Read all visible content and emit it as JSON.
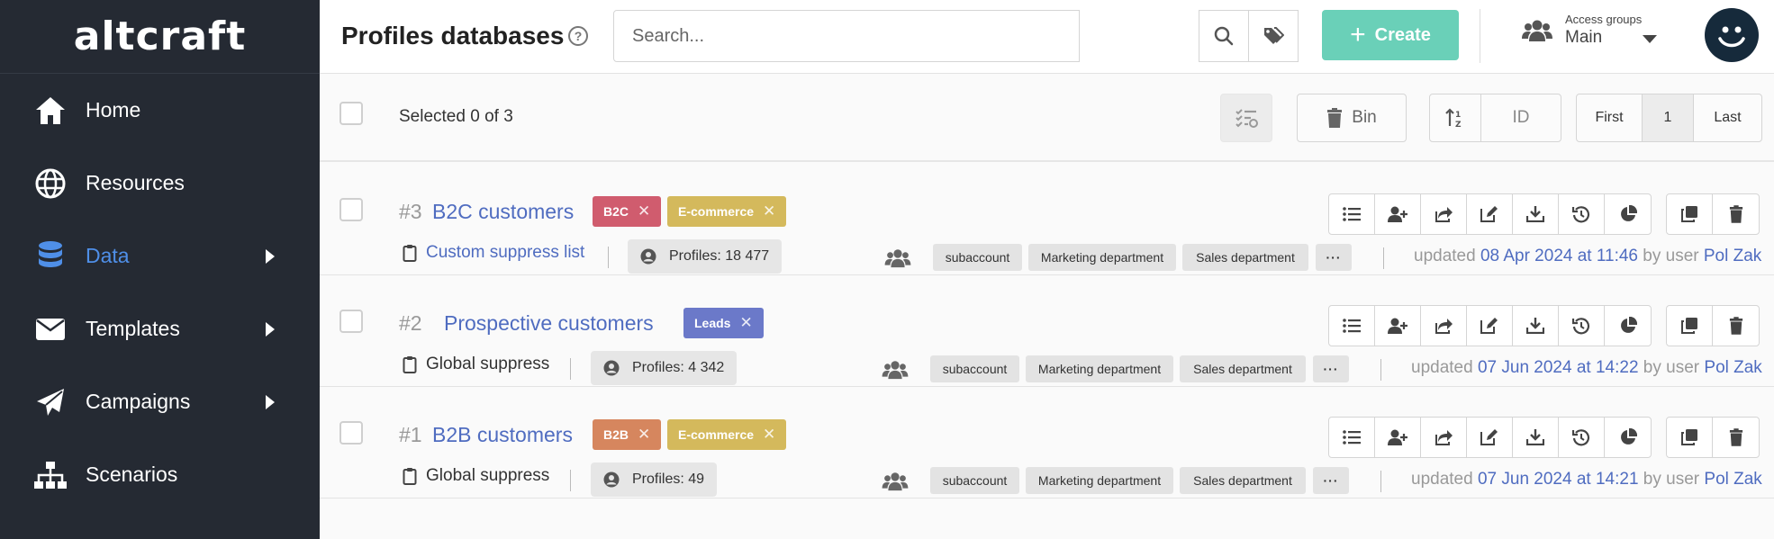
{
  "sidebar": {
    "logo": "altcraft",
    "items": [
      {
        "label": "Home",
        "icon": "home-icon"
      },
      {
        "label": "Resources",
        "icon": "globe-icon"
      },
      {
        "label": "Data",
        "icon": "database-icon"
      },
      {
        "label": "Templates",
        "icon": "envelope-icon"
      },
      {
        "label": "Campaigns",
        "icon": "paper-plane-icon"
      },
      {
        "label": "Scenarios",
        "icon": "sitemap-icon"
      }
    ]
  },
  "header": {
    "title": "Profiles databases",
    "help": "?",
    "search_placeholder": "Search...",
    "create_label": "Create",
    "access_caption": "Access groups",
    "access_value": "Main"
  },
  "toolbar": {
    "selected_text": "Selected 0 of 3",
    "bin_label": "Bin",
    "sort_field": "ID",
    "pager_first": "First",
    "pager_page": "1",
    "pager_last": "Last"
  },
  "rows": [
    {
      "id": "#3",
      "name": "B2C customers",
      "tags": [
        {
          "label": "B2C",
          "color": "#d05c6e"
        },
        {
          "label": "E-commerce",
          "color": "#d4b95c"
        }
      ],
      "suppress": "Custom suppress list",
      "profiles": "Profiles: 18 477",
      "groups": [
        "subaccount",
        "Marketing department",
        "Sales department"
      ],
      "more": "···",
      "updated_prefix": "updated",
      "updated_date": "08 Apr 2024 at 11:46",
      "updated_by": "by user",
      "user": "Pol Zak"
    },
    {
      "id": "#2",
      "name": "Prospective customers",
      "tags": [
        {
          "label": "Leads",
          "color": "#6b79c9"
        }
      ],
      "suppress": "Global suppress",
      "profiles": "Profiles: 4 342",
      "groups": [
        "subaccount",
        "Marketing department",
        "Sales department"
      ],
      "more": "···",
      "updated_prefix": "updated",
      "updated_date": "07 Jun 2024 at 14:22",
      "updated_by": "by user",
      "user": "Pol Zak"
    },
    {
      "id": "#1",
      "name": "B2B customers",
      "tags": [
        {
          "label": "B2B",
          "color": "#d6865e"
        },
        {
          "label": "E-commerce",
          "color": "#d4b95c"
        }
      ],
      "suppress": "Global suppress",
      "profiles": "Profiles: 49",
      "groups": [
        "subaccount",
        "Marketing department",
        "Sales department"
      ],
      "more": "···",
      "updated_prefix": "updated",
      "updated_date": "07 Jun 2024 at 14:21",
      "updated_by": "by user",
      "user": "Pol Zak"
    }
  ],
  "colors": {
    "sidebar_bg": "#252a33",
    "accent": "#4f8fe8",
    "link": "#4f6cc0",
    "create": "#6ad0b8"
  }
}
